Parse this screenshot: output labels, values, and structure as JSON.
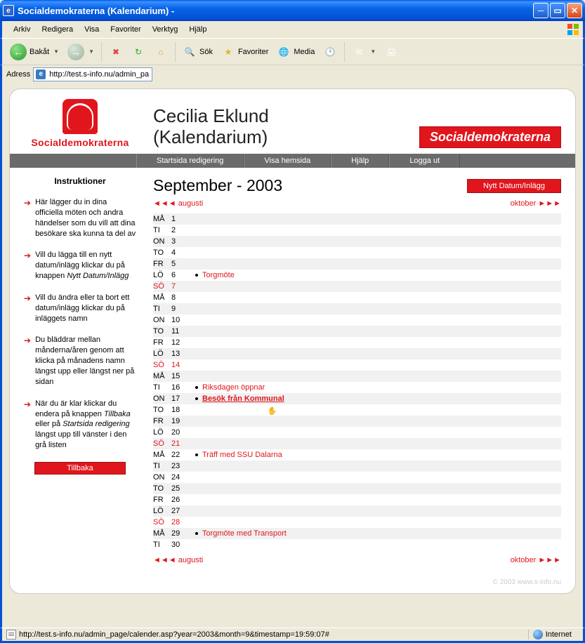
{
  "window": {
    "title": "Socialdemokraterna (Kalendarium) -"
  },
  "menubar": [
    "Arkiv",
    "Redigera",
    "Visa",
    "Favoriter",
    "Verktyg",
    "Hjälp"
  ],
  "toolbar": {
    "back": "Bakåt",
    "search": "Sök",
    "favorites": "Favoriter",
    "media": "Media"
  },
  "address": {
    "label": "Adress",
    "url": "http://test.s-info.nu/admin_page/calender.asp?year=2003&month=9&timestamp=19:59:07"
  },
  "page": {
    "logo_text": "Socialdemokraterna",
    "title_line1": "Cecilia Eklund",
    "title_line2": "(Kalendarium)",
    "brand_button": "Socialdemokraterna",
    "navbar": [
      "Startsida redigering",
      "Visa hemsida",
      "Hjälp",
      "Logga ut"
    ]
  },
  "sidebar": {
    "heading": "Instruktioner",
    "items": [
      {
        "text": "Här lägger du in dina officiella möten och andra händelser som du vill att dina besökare ska kunna ta del av"
      },
      {
        "text": "Vill du lägga till en nytt datum/inlägg klickar du på knappen ",
        "italic": "Nytt Datum/Inlägg"
      },
      {
        "text": "Vill du ändra eller ta bort ett datum/inlägg klickar du på inläggets namn"
      },
      {
        "text": "Du bläddrar mellan månderna/åren genom att klicka på månadens namn längst upp eller längst ner på sidan"
      },
      {
        "text": "När du är klar klickar du endera på knappen ",
        "italic": "Tillbaka",
        "text2": " eller på ",
        "italic2": "Startsida redigering",
        "text3": " längst upp till vänster i den grå listen"
      }
    ],
    "back_button": "Tillbaka"
  },
  "calendar": {
    "month_title": "September - 2003",
    "new_entry": "Nytt Datum/Inlägg",
    "prev_label": "◄◄◄ augusti",
    "next_label": "oktober ►►►",
    "days": [
      {
        "wd": "MÅ",
        "d": "1",
        "sun": false,
        "event": null
      },
      {
        "wd": "TI",
        "d": "2",
        "sun": false,
        "event": null
      },
      {
        "wd": "ON",
        "d": "3",
        "sun": false,
        "event": null
      },
      {
        "wd": "TO",
        "d": "4",
        "sun": false,
        "event": null
      },
      {
        "wd": "FR",
        "d": "5",
        "sun": false,
        "event": null
      },
      {
        "wd": "LÖ",
        "d": "6",
        "sun": false,
        "event": "Torgmöte"
      },
      {
        "wd": "SÖ",
        "d": "7",
        "sun": true,
        "event": null
      },
      {
        "wd": "MÅ",
        "d": "8",
        "sun": false,
        "event": null
      },
      {
        "wd": "TI",
        "d": "9",
        "sun": false,
        "event": null
      },
      {
        "wd": "ON",
        "d": "10",
        "sun": false,
        "event": null
      },
      {
        "wd": "TO",
        "d": "11",
        "sun": false,
        "event": null
      },
      {
        "wd": "FR",
        "d": "12",
        "sun": false,
        "event": null
      },
      {
        "wd": "LÖ",
        "d": "13",
        "sun": false,
        "event": null
      },
      {
        "wd": "SÖ",
        "d": "14",
        "sun": true,
        "event": null
      },
      {
        "wd": "MÅ",
        "d": "15",
        "sun": false,
        "event": null
      },
      {
        "wd": "TI",
        "d": "16",
        "sun": false,
        "event": "Riksdagen öppnar"
      },
      {
        "wd": "ON",
        "d": "17",
        "sun": false,
        "event": "Besök från Kommunal",
        "hover": true
      },
      {
        "wd": "TO",
        "d": "18",
        "sun": false,
        "event": null
      },
      {
        "wd": "FR",
        "d": "19",
        "sun": false,
        "event": null
      },
      {
        "wd": "LÖ",
        "d": "20",
        "sun": false,
        "event": null
      },
      {
        "wd": "SÖ",
        "d": "21",
        "sun": true,
        "event": null
      },
      {
        "wd": "MÅ",
        "d": "22",
        "sun": false,
        "event": "Träff med SSU Dalarna"
      },
      {
        "wd": "TI",
        "d": "23",
        "sun": false,
        "event": null
      },
      {
        "wd": "ON",
        "d": "24",
        "sun": false,
        "event": null
      },
      {
        "wd": "TO",
        "d": "25",
        "sun": false,
        "event": null
      },
      {
        "wd": "FR",
        "d": "26",
        "sun": false,
        "event": null
      },
      {
        "wd": "LÖ",
        "d": "27",
        "sun": false,
        "event": null
      },
      {
        "wd": "SÖ",
        "d": "28",
        "sun": true,
        "event": null
      },
      {
        "wd": "MÅ",
        "d": "29",
        "sun": false,
        "event": "Torgmöte med Transport"
      },
      {
        "wd": "TI",
        "d": "30",
        "sun": false,
        "event": null
      }
    ],
    "copyright": "© 2003 www.s-info.nu"
  },
  "statusbar": {
    "text": "http://test.s-info.nu/admin_page/calender.asp?year=2003&month=9&timestamp=19:59:07#",
    "zone": "Internet"
  }
}
